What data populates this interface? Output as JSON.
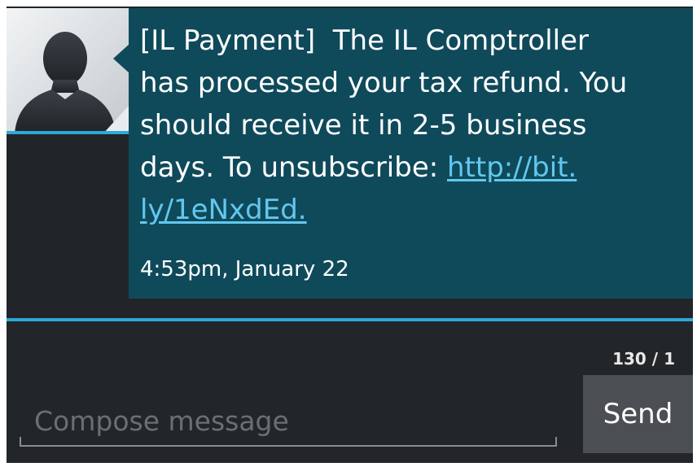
{
  "conversation": {
    "avatar_icon": "person-silhouette-icon",
    "message": {
      "text_before_link": "[IL Payment]  The IL Comptroller\nhas processed your tax refund. You\nshould receive it in 2-5 business\ndays. To unsubscribe: ",
      "link_text": "http://bit.\nly/1eNxdEd.",
      "timestamp": "4:53pm, January 22"
    }
  },
  "composer": {
    "char_counter": "130 / 1",
    "placeholder": "Compose message",
    "value": "",
    "send_label": "Send"
  },
  "colors": {
    "bubble": "#0f4a5b",
    "accent": "#2fa7d8",
    "link": "#63c7ee",
    "background": "#222529",
    "send_button": "#4b4e52"
  }
}
